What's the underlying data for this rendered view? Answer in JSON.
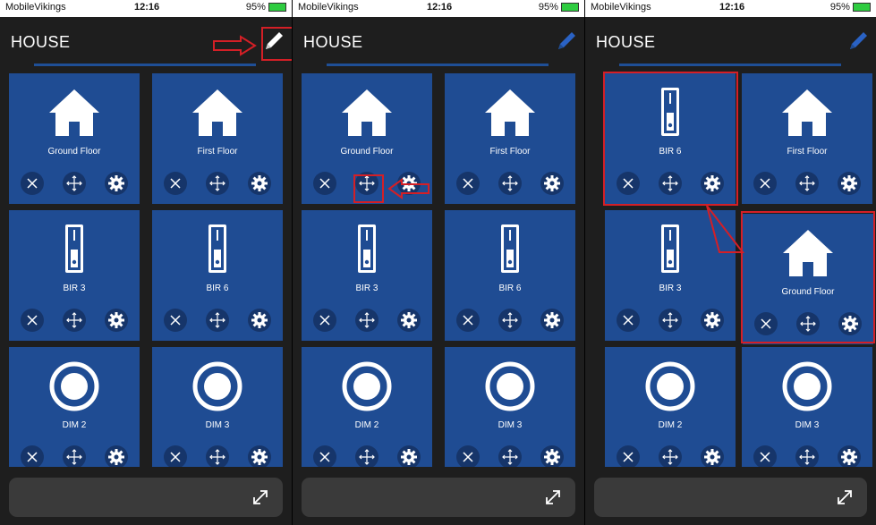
{
  "colors": {
    "tile": "#1f4c93",
    "background": "#1e1e1e",
    "highlight": "#d41f26",
    "accent": "#2a62c4"
  },
  "status": {
    "carrier": "MobileVikings",
    "time": "12:16",
    "battery": "95%"
  },
  "header": {
    "title": "HOUSE",
    "edit_icon": "pencil-icon"
  },
  "actions": {
    "remove_icon": "close-icon",
    "move_icon": "move-icon",
    "settings_icon": "gear-icon"
  },
  "bottom": {
    "expand_icon": "expand-icon"
  },
  "panels": [
    {
      "tiles": [
        {
          "label": "Ground Floor",
          "icon": "house-icon"
        },
        {
          "label": "First Floor",
          "icon": "house-icon"
        },
        {
          "label": "BIR 3",
          "icon": "blind-switch-icon"
        },
        {
          "label": "BIR 6",
          "icon": "blind-switch-icon"
        },
        {
          "label": "DIM 2",
          "icon": "dimmer-icon"
        },
        {
          "label": "DIM 3",
          "icon": "dimmer-icon"
        }
      ]
    },
    {
      "tiles": [
        {
          "label": "Ground Floor",
          "icon": "house-icon"
        },
        {
          "label": "First Floor",
          "icon": "house-icon"
        },
        {
          "label": "BIR 3",
          "icon": "blind-switch-icon"
        },
        {
          "label": "BIR 6",
          "icon": "blind-switch-icon"
        },
        {
          "label": "DIM 2",
          "icon": "dimmer-icon"
        },
        {
          "label": "DIM 3",
          "icon": "dimmer-icon"
        }
      ]
    },
    {
      "tiles": [
        {
          "label": "BIR 6",
          "icon": "blind-switch-icon"
        },
        {
          "label": "First Floor",
          "icon": "house-icon"
        },
        {
          "label": "BIR 3",
          "icon": "blind-switch-icon"
        },
        {
          "label": "Ground Floor",
          "icon": "house-icon"
        },
        {
          "label": "DIM 2",
          "icon": "dimmer-icon"
        },
        {
          "label": "DIM 3",
          "icon": "dimmer-icon"
        }
      ]
    }
  ]
}
